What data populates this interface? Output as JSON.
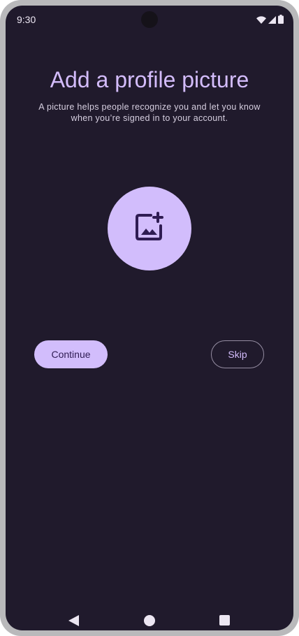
{
  "status_bar": {
    "time": "9:30",
    "icons": [
      "wifi-icon",
      "signal-icon",
      "battery-icon"
    ]
  },
  "main": {
    "title": "Add a profile picture",
    "subtitle": "A picture helps people recognize you and let you know when you’re signed in to your account.",
    "avatar_icon": "add-photo-icon"
  },
  "actions": {
    "continue_label": "Continue",
    "skip_label": "Skip"
  },
  "nav": {
    "icons": [
      "back-icon",
      "home-icon",
      "recents-icon"
    ]
  },
  "colors": {
    "background": "#201a2c",
    "accent": "#d2bdfc",
    "title": "#d3bcfb",
    "on_accent": "#2f1c53"
  }
}
